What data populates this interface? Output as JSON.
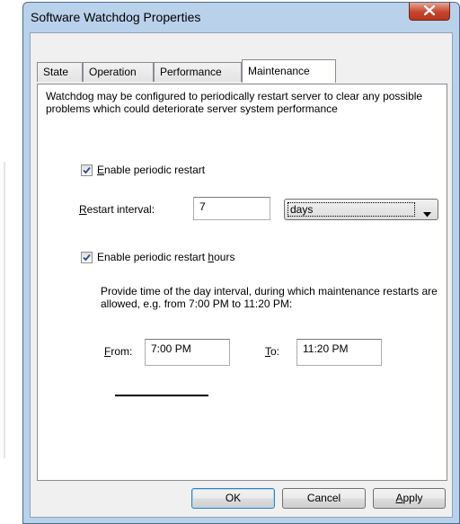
{
  "window": {
    "title": "Software Watchdog Properties"
  },
  "tabs": [
    {
      "label": "State",
      "active": false
    },
    {
      "label": "Operation",
      "active": false
    },
    {
      "label": "Performance",
      "active": false
    },
    {
      "label": "Maintenance",
      "active": true
    }
  ],
  "maintenance": {
    "description": "Watchdog may be configured to periodically restart server to clear any possible problems which could deteriorate server system performance",
    "enable_restart": {
      "accel": "E",
      "rest": "nable periodic restart",
      "checked": true
    },
    "restart_interval": {
      "accel": "R",
      "rest": "estart interval:",
      "value": "7",
      "unit": "days"
    },
    "enable_hours": {
      "pre": "Enable periodic restart ",
      "accel": "h",
      "rest": "ours",
      "checked": true
    },
    "hours_info": "Provide time of the day interval, during which maintenance restarts are allowed, e.g. from 7:00 PM to 11:20 PM:",
    "from": {
      "accel": "F",
      "rest": "rom:",
      "value": "7:00 PM"
    },
    "to": {
      "accel": "T",
      "rest": "o:",
      "value": "11:20 PM"
    }
  },
  "buttons": {
    "ok": "OK",
    "cancel": "Cancel",
    "apply_accel": "A",
    "apply_rest": "pply"
  },
  "icons": {
    "close": "close-icon",
    "check": "checkmark-icon",
    "dropdown": "chevron-down-icon"
  },
  "colors": {
    "frame": "#b9d1ea",
    "close_button": "#c7452b",
    "dialog_bg": "#f0f0f0",
    "panel_bg": "#ffffff"
  }
}
